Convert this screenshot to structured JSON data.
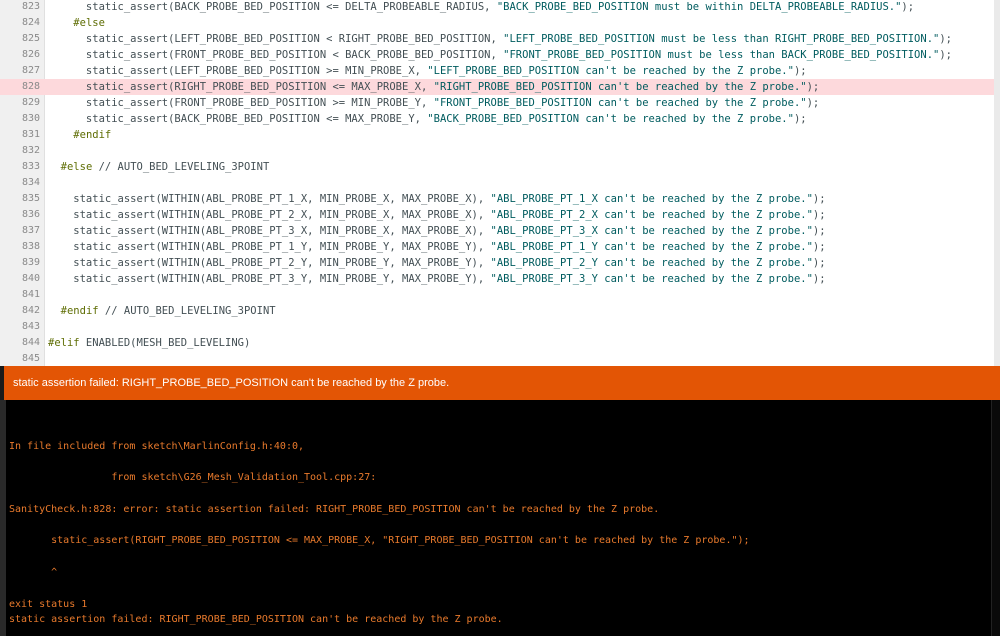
{
  "editor": {
    "lines": [
      {
        "n": "823",
        "code": "      static_assert(BACK_PROBE_BED_POSITION <= DELTA_PROBEABLE_RADIUS, \"BACK_PROBE_BED_POSITION must be within DELTA_PROBEABLE_RADIUS.\");"
      },
      {
        "n": "824",
        "code": "    #else"
      },
      {
        "n": "825",
        "code": "      static_assert(LEFT_PROBE_BED_POSITION < RIGHT_PROBE_BED_POSITION, \"LEFT_PROBE_BED_POSITION must be less than RIGHT_PROBE_BED_POSITION.\");"
      },
      {
        "n": "826",
        "code": "      static_assert(FRONT_PROBE_BED_POSITION < BACK_PROBE_BED_POSITION, \"FRONT_PROBE_BED_POSITION must be less than BACK_PROBE_BED_POSITION.\");"
      },
      {
        "n": "827",
        "code": "      static_assert(LEFT_PROBE_BED_POSITION >= MIN_PROBE_X, \"LEFT_PROBE_BED_POSITION can't be reached by the Z probe.\");"
      },
      {
        "n": "828",
        "code": "      static_assert(RIGHT_PROBE_BED_POSITION <= MAX_PROBE_X, \"RIGHT_PROBE_BED_POSITION can't be reached by the Z probe.\");"
      },
      {
        "n": "829",
        "code": "      static_assert(FRONT_PROBE_BED_POSITION >= MIN_PROBE_Y, \"FRONT_PROBE_BED_POSITION can't be reached by the Z probe.\");"
      },
      {
        "n": "830",
        "code": "      static_assert(BACK_PROBE_BED_POSITION <= MAX_PROBE_Y, \"BACK_PROBE_BED_POSITION can't be reached by the Z probe.\");"
      },
      {
        "n": "831",
        "code": "    #endif"
      },
      {
        "n": "832",
        "code": ""
      },
      {
        "n": "833",
        "code": "  #else // AUTO_BED_LEVELING_3POINT"
      },
      {
        "n": "834",
        "code": ""
      },
      {
        "n": "835",
        "code": "    static_assert(WITHIN(ABL_PROBE_PT_1_X, MIN_PROBE_X, MAX_PROBE_X), \"ABL_PROBE_PT_1_X can't be reached by the Z probe.\");"
      },
      {
        "n": "836",
        "code": "    static_assert(WITHIN(ABL_PROBE_PT_2_X, MIN_PROBE_X, MAX_PROBE_X), \"ABL_PROBE_PT_2_X can't be reached by the Z probe.\");"
      },
      {
        "n": "837",
        "code": "    static_assert(WITHIN(ABL_PROBE_PT_3_X, MIN_PROBE_X, MAX_PROBE_X), \"ABL_PROBE_PT_3_X can't be reached by the Z probe.\");"
      },
      {
        "n": "838",
        "code": "    static_assert(WITHIN(ABL_PROBE_PT_1_Y, MIN_PROBE_Y, MAX_PROBE_Y), \"ABL_PROBE_PT_1_Y can't be reached by the Z probe.\");"
      },
      {
        "n": "839",
        "code": "    static_assert(WITHIN(ABL_PROBE_PT_2_Y, MIN_PROBE_Y, MAX_PROBE_Y), \"ABL_PROBE_PT_2_Y can't be reached by the Z probe.\");"
      },
      {
        "n": "840",
        "code": "    static_assert(WITHIN(ABL_PROBE_PT_3_Y, MIN_PROBE_Y, MAX_PROBE_Y), \"ABL_PROBE_PT_3_Y can't be reached by the Z probe.\");"
      },
      {
        "n": "841",
        "code": ""
      },
      {
        "n": "842",
        "code": "  #endif // AUTO_BED_LEVELING_3POINT"
      },
      {
        "n": "843",
        "code": ""
      },
      {
        "n": "844",
        "code": "#elif ENABLED(MESH_BED_LEVELING)"
      },
      {
        "n": "845",
        "code": ""
      }
    ],
    "highlighted_line": "828"
  },
  "error_bar": {
    "message": "static assertion failed: RIGHT_PROBE_BED_POSITION can't be reached by the Z probe."
  },
  "console": {
    "lines": [
      "",
      "",
      "In file included from sketch\\MarlinConfig.h:40:0,",
      "",
      "                 from sketch\\G26_Mesh_Validation_Tool.cpp:27:",
      "",
      "SanityCheck.h:828: error: static assertion failed: RIGHT_PROBE_BED_POSITION can't be reached by the Z probe.",
      "",
      "       static_assert(RIGHT_PROBE_BED_POSITION <= MAX_PROBE_X, \"RIGHT_PROBE_BED_POSITION can't be reached by the Z probe.\");",
      "",
      "       ^",
      "",
      "exit status 1",
      "static assertion failed: RIGHT_PROBE_BED_POSITION can't be reached by the Z probe."
    ]
  },
  "colors": {
    "error_bar": "#e35505",
    "console_text": "#e97a2c",
    "highlight": "#fdd9dc",
    "preprocessor": "#5e6d03",
    "string": "#005c5f"
  }
}
